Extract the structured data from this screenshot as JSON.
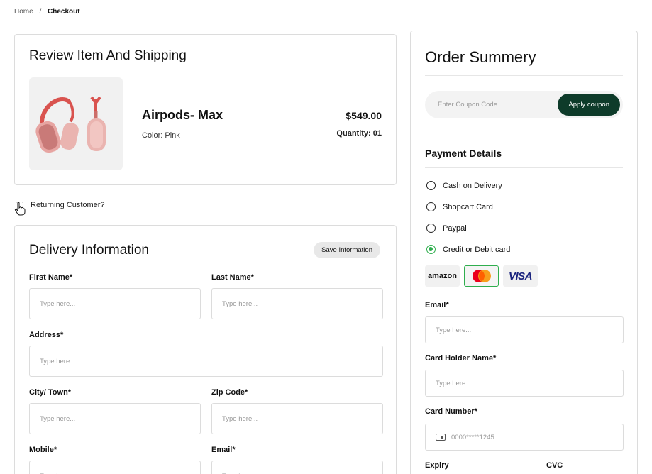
{
  "breadcrumb": {
    "home": "Home",
    "separator": "/",
    "current": "Checkout"
  },
  "review": {
    "title": "Review Item And Shipping",
    "product": {
      "name": "Airpods- Max",
      "color": "Color: Pink",
      "price": "$549.00",
      "quantity": "Quantity: 01",
      "image_icon": "headphones-image"
    }
  },
  "returning": {
    "label": "Returning Customer?"
  },
  "delivery": {
    "title": "Delivery Information",
    "save_label": "Save Information",
    "fields": {
      "first_name": {
        "label": "First Name*",
        "placeholder": "Type here..."
      },
      "last_name": {
        "label": "Last Name*",
        "placeholder": "Type here..."
      },
      "address": {
        "label": "Address*",
        "placeholder": "Type here..."
      },
      "city": {
        "label": "City/ Town*",
        "placeholder": "Type here..."
      },
      "zip": {
        "label": "Zip Code*",
        "placeholder": "Type here..."
      },
      "mobile": {
        "label": "Mobile*",
        "placeholder": "Type here..."
      },
      "email": {
        "label": "Email*",
        "placeholder": "Type here..."
      }
    }
  },
  "summary": {
    "title": "Order Summery",
    "coupon": {
      "placeholder": "Enter Coupon Code",
      "button": "Apply coupon"
    },
    "payment_title": "Payment Details",
    "payment_options": [
      {
        "label": "Cash on Delivery",
        "selected": false
      },
      {
        "label": "Shopcart Card",
        "selected": false
      },
      {
        "label": "Paypal",
        "selected": false
      },
      {
        "label": "Credit or Debit card",
        "selected": true
      }
    ],
    "card_logos": {
      "amazon": "amazon",
      "mastercard": "mastercard-logo",
      "visa": "VISA",
      "selected": "mastercard"
    },
    "email": {
      "label": "Email*",
      "placeholder": "Type here..."
    },
    "holder": {
      "label": "Card Holder Name*",
      "placeholder": "Type here..."
    },
    "number": {
      "label": "Card Number*",
      "value": "0000*****1245"
    },
    "expiry": {
      "label": "Expiry"
    },
    "cvc": {
      "label": "CVC"
    }
  },
  "colors": {
    "accent_dark_green": "#0e3b2a",
    "selected_green": "#2fae4e",
    "visa_blue": "#1a237e"
  }
}
